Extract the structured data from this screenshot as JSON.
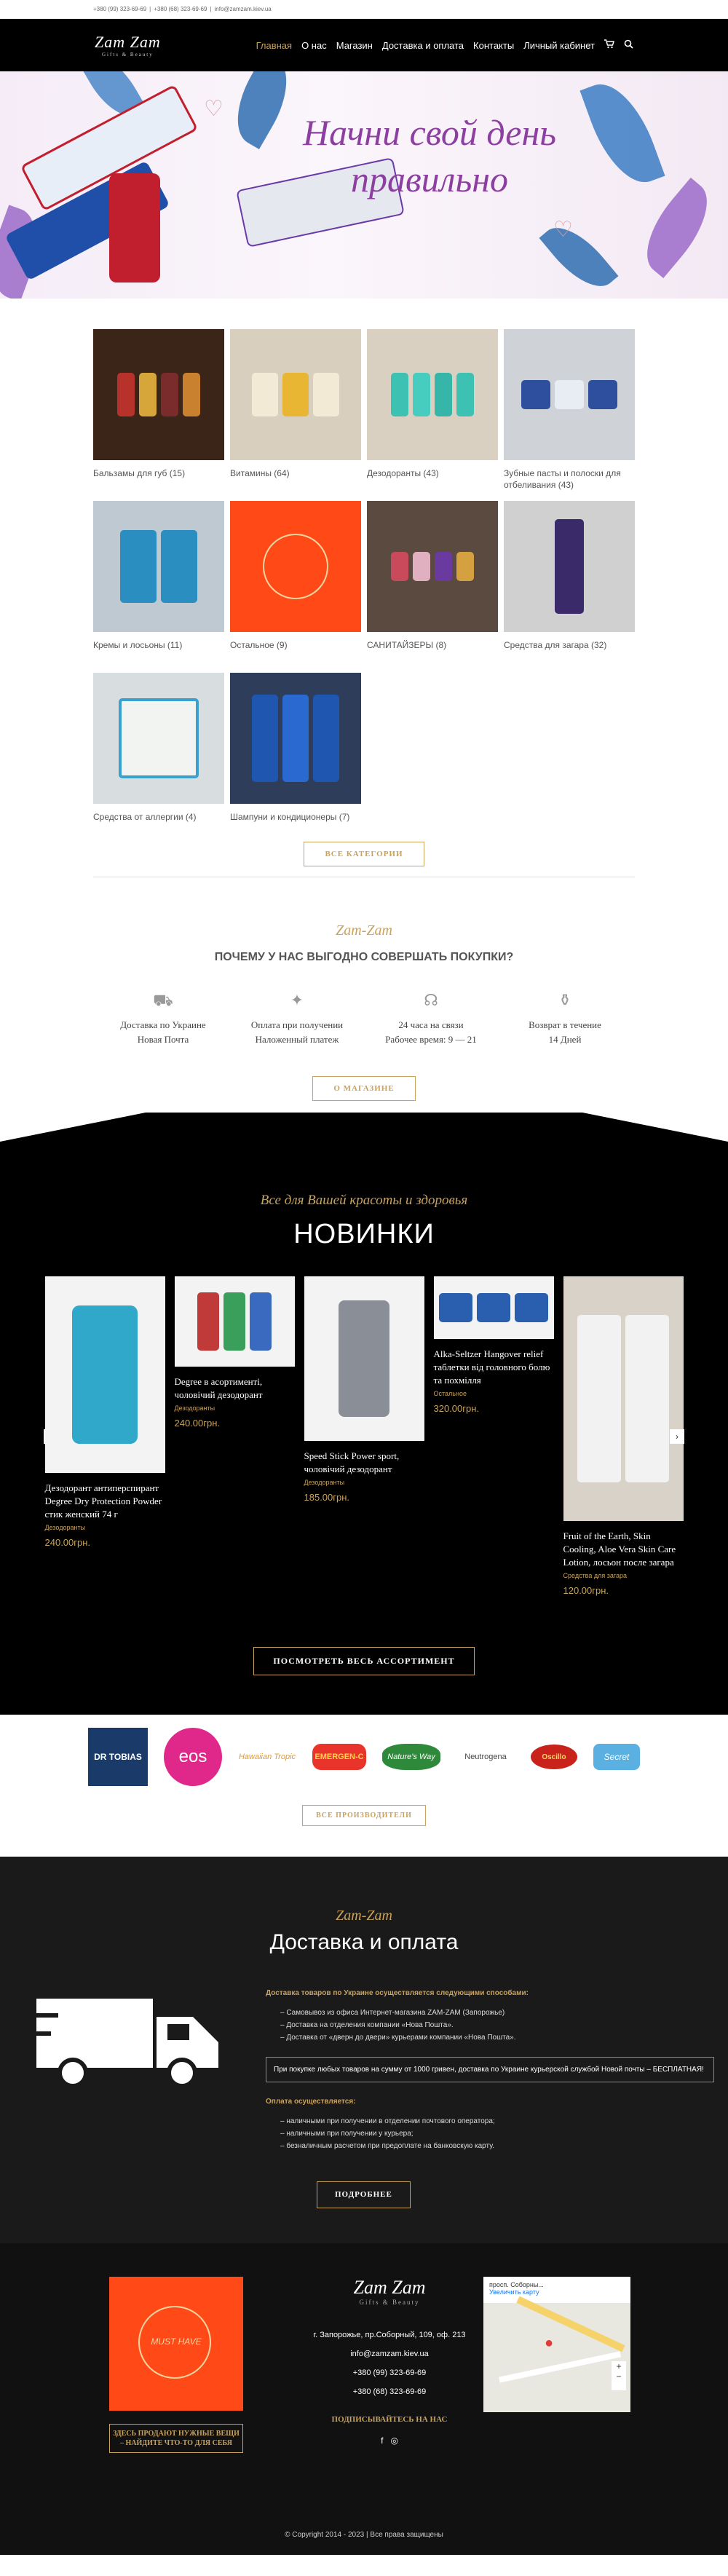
{
  "topbar": {
    "phone1": "+380 (99) 323-69-69",
    "phone2": "+380 (68) 323-69-69",
    "email": "info@zamzam.kiev.ua",
    "sep": "|"
  },
  "header": {
    "logo": "Zam Zam",
    "logo_sub": "Gifts & Beauty",
    "nav": [
      "Главная",
      "О нас",
      "Магазин",
      "Доставка и оплата",
      "Контакты",
      "Личный кабинет"
    ],
    "cart_icon": "cart-icon",
    "search_icon": "search-icon"
  },
  "hero": {
    "title": "Начни свой день правильно"
  },
  "categories": [
    {
      "label": "Бальзамы для губ (15)"
    },
    {
      "label": "Витамины (64)"
    },
    {
      "label": "Дезодоранты (43)"
    },
    {
      "label": "Зубные пасты и полоски для отбеливания (43)"
    },
    {
      "label": "Кремы и лосьоны (11)"
    },
    {
      "label": "Остальное (9)"
    },
    {
      "label": "САНИТАЙЗЕРЫ (8)"
    },
    {
      "label": "Средства для загара (32)"
    },
    {
      "label": "Средства от аллергии (4)"
    },
    {
      "label": "Шампуни и кондиционеры (7)"
    }
  ],
  "all_categories_btn": "ВСЕ КАТЕГОРИИ",
  "why": {
    "brand": "Zam-Zam",
    "title": "ПОЧЕМУ У НАС ВЫГОДНО СОВЕРШАТЬ ПОКУПКИ?",
    "features": [
      {
        "line1": "Доставка по Украине",
        "line2": "Новая Почта"
      },
      {
        "line1": "Оплата при получении",
        "line2": "Наложенный платеж"
      },
      {
        "line1": "24 часа на связи",
        "line2": "Рабочее время: 9 — 21"
      },
      {
        "line1": "Возврат в течение",
        "line2": "14 Дней"
      }
    ],
    "about_btn": "О МАГАЗИНЕ"
  },
  "novinki": {
    "sub": "Все для Вашей красоты и здоровья",
    "title": "НОВИНКИ",
    "products": [
      {
        "name": "Дезодорант антиперспирант Degree Dry Protection Powder стик женский 74 г",
        "cat": "Дезодоранты",
        "price": "240.00грн."
      },
      {
        "name": "Degree в асортименті, чоловічий дезодорант",
        "cat": "Дезодоранты",
        "price": "240.00грн."
      },
      {
        "name": "Speed Stick Power sport, чоловічий дезодорант",
        "cat": "Дезодоранты",
        "price": "185.00грн."
      },
      {
        "name": "Alka-Seltzer Hangover relief таблетки від головного болю та похмілля",
        "cat": "Остальное",
        "price": "320.00грн."
      },
      {
        "name": "Fruit of the Earth, Skin Cooling, Aloe Vera Skin Care Lotion, лосьон после загара",
        "cat": "Средства для загара",
        "price": "120.00грн."
      }
    ],
    "all_btn": "ПОСМОТРЕТЬ ВЕСЬ АССОРТИМЕНТ"
  },
  "brands": {
    "items": [
      "DR TOBIAS",
      "eos",
      "Hawaiian Tropic",
      "EMERGEN-C",
      "Nature's Way",
      "Neutrogena",
      "Oscillo",
      "Secret"
    ],
    "all_btn": "ВСЕ ПРОИЗВОДИТЕЛИ"
  },
  "delivery": {
    "sub": "Zam-Zam",
    "title": "Доставка и оплата",
    "intro": "Доставка товаров по Украине осуществляется следующими способами:",
    "methods": [
      "Самовывоз из офиса Интернет-магазина ZAM-ZAM (Запорожье)",
      "Доставка на отделения компании «Нова Пошта».",
      "Доставка от «дверн до двери» курьерами компании «Нова Пошта»."
    ],
    "note": "При покупке любых товаров на сумму от 1000 гривен, доставка по Украине курьерской службой Новой почты – БЕСПЛАТНАЯ!",
    "pay_title": "Оплата осуществляется:",
    "payments": [
      "наличными при получении в отделении почтового оператора;",
      "наличными при получении у курьера;",
      "безналичным расчетом при предоплате на банковскую карту."
    ],
    "more_btn": "ПОДРОБНЕЕ"
  },
  "footer": {
    "img_text": "MUST HAVE",
    "promo_btn": "ЗДЕСЬ ПРОДАЮТ НУЖНЫЕ ВЕЩИ – НАЙДИТЕ ЧТО-ТО ДЛЯ СЕБЯ",
    "logo": "Zam Zam",
    "logo_sub": "Gifts & Beauty",
    "address": "г. Запорожье, пр.Соборный, 109, оф. 213",
    "email": "info@zamzam.kiev.ua",
    "phone1": "+380 (99) 323-69-69",
    "phone2": "+380 (68) 323-69-69",
    "subscribe": "ПОДПИСЫВАЙТЕСЬ НА НАС",
    "map_title": "просп. Соборны...",
    "map_link": "Увеличить карту",
    "copyright": "© Copyright 2014 - 2023 | Все права защищены"
  }
}
